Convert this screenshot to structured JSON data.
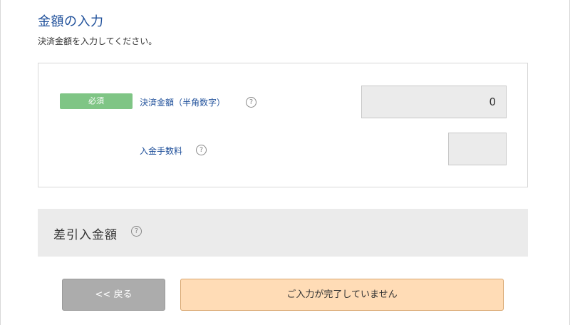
{
  "section": {
    "title": "金額の入力",
    "description": "決済金額を入力してください。"
  },
  "payment_form": {
    "required_badge": "必須",
    "amount_label": "決済金額（半角数字）",
    "amount_value": "0",
    "fee_label": "入金手数料",
    "fee_value": ""
  },
  "deduction": {
    "title": "差引入金額"
  },
  "help_icon_glyph": "?",
  "buttons": {
    "back_label": "<< 戻る",
    "submit_label": "ご入力が完了していません"
  },
  "colors": {
    "title_blue": "#1e4f9a",
    "required_green": "#7fc585",
    "submit_bg": "#ffdcb6",
    "back_bg": "#acacac"
  }
}
